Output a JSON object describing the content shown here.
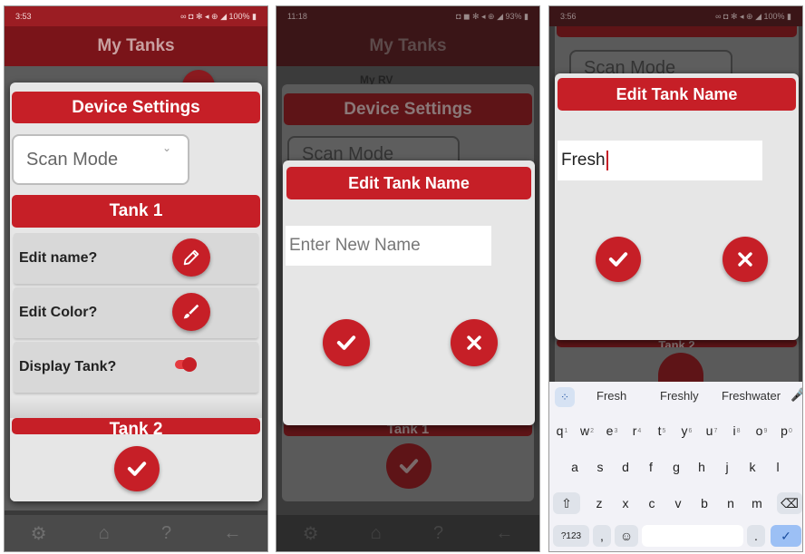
{
  "phone1": {
    "status_time": "3:53",
    "status_right": "∞ ◘ ✻ ◂ ⊕ ◢ 100% ▮",
    "app_title": "My Tanks",
    "dialog_title": "Device Settings",
    "scan_mode": "Scan Mode",
    "tank1": "Tank 1",
    "edit_name": "Edit name?",
    "edit_color": "Edit Color?",
    "display_tank": "Display Tank?",
    "tank2": "Tank 2"
  },
  "phone2": {
    "status_time": "11:18",
    "status_right": "◘ ◼ ✻ ◂ ⊕ ◢ 93% ▮",
    "app_title": "My Tanks",
    "behind_label": "My RV",
    "behind_dialog_title": "Device Settings",
    "behind_scan_mode": "Scan Mode",
    "dialog_title": "Edit Tank Name",
    "input_placeholder": "Enter New Name",
    "behind_tank1": "Tank 1"
  },
  "phone3": {
    "status_time": "3:56",
    "status_right": "∞ ◘ ✻ ◂ ⊕ ◢ 100% ▮",
    "behind_scan_mode": "Scan Mode",
    "dialog_title": "Edit Tank Name",
    "input_value": "Fresh",
    "behind_tank2": "Tank 2",
    "suggestions": [
      "Fresh",
      "Freshly",
      "Freshwater"
    ],
    "row1": [
      "q",
      "w",
      "e",
      "r",
      "t",
      "y",
      "u",
      "i",
      "o",
      "p"
    ],
    "row1_hints": [
      "1",
      "2",
      "3",
      "4",
      "5",
      "6",
      "7",
      "8",
      "9",
      "0"
    ],
    "row2": [
      "a",
      "s",
      "d",
      "f",
      "g",
      "h",
      "j",
      "k",
      "l"
    ],
    "row3": [
      "z",
      "x",
      "c",
      "v",
      "b",
      "n",
      "m"
    ],
    "sym_key": "?123",
    "comma_key": ",",
    "period_key": "."
  },
  "colors": {
    "brand_red": "#c61f27",
    "dark_red": "#7a1419"
  }
}
